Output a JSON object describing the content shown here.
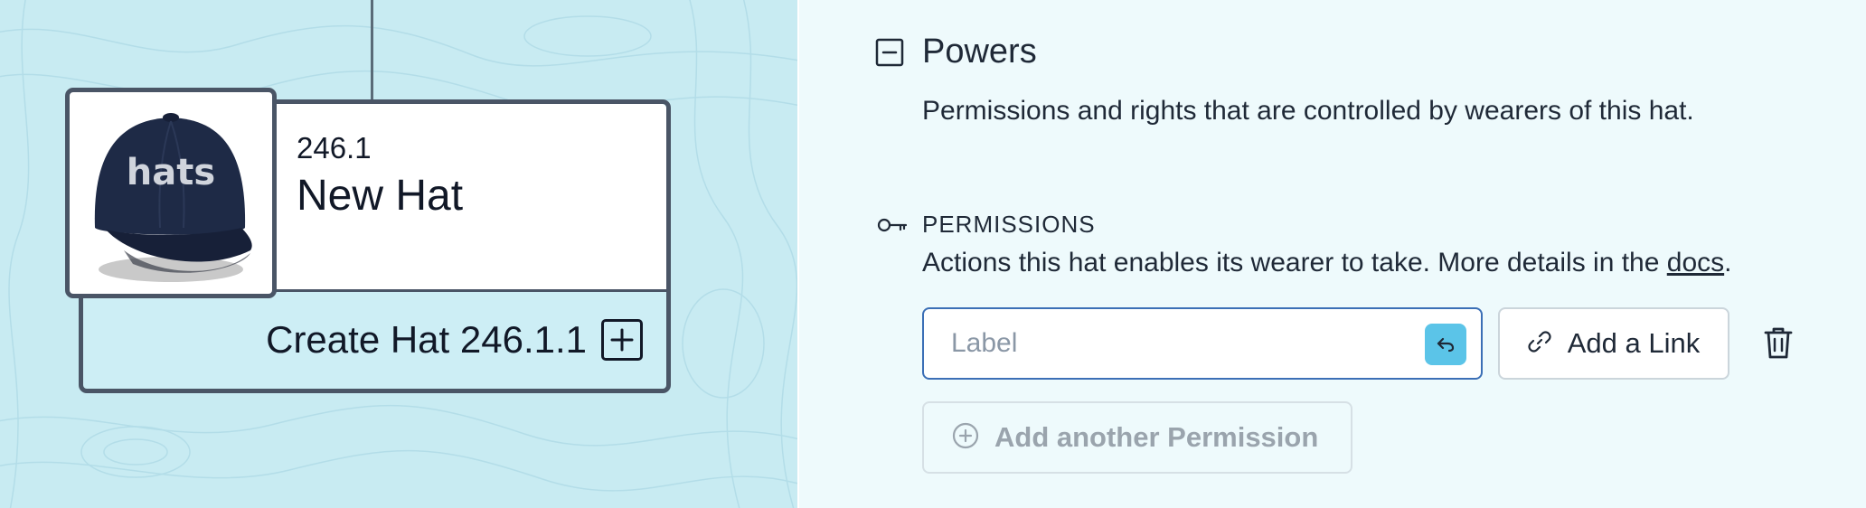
{
  "canvas": {
    "hat_card": {
      "id": "246.1",
      "name": "New Hat",
      "image_text": "hats",
      "create_label": "Create Hat 246.1.1"
    }
  },
  "panel": {
    "section": {
      "title": "Powers",
      "description": "Permissions and rights that are controlled by wearers of this hat.",
      "icon": "collapse-minus-icon"
    },
    "permissions": {
      "heading": "PERMISSIONS",
      "description_prefix": "Actions this hat enables its wearer to take. More details in the ",
      "docs_link": "docs",
      "description_suffix": ".",
      "label_placeholder": "Label",
      "add_link_label": "Add a Link",
      "add_another_label": "Add another Permission"
    }
  },
  "colors": {
    "canvas_bg": "#c8ebf2",
    "panel_bg": "#eefafc",
    "accent": "#5bc4e8",
    "input_border": "#3b6fb6"
  }
}
